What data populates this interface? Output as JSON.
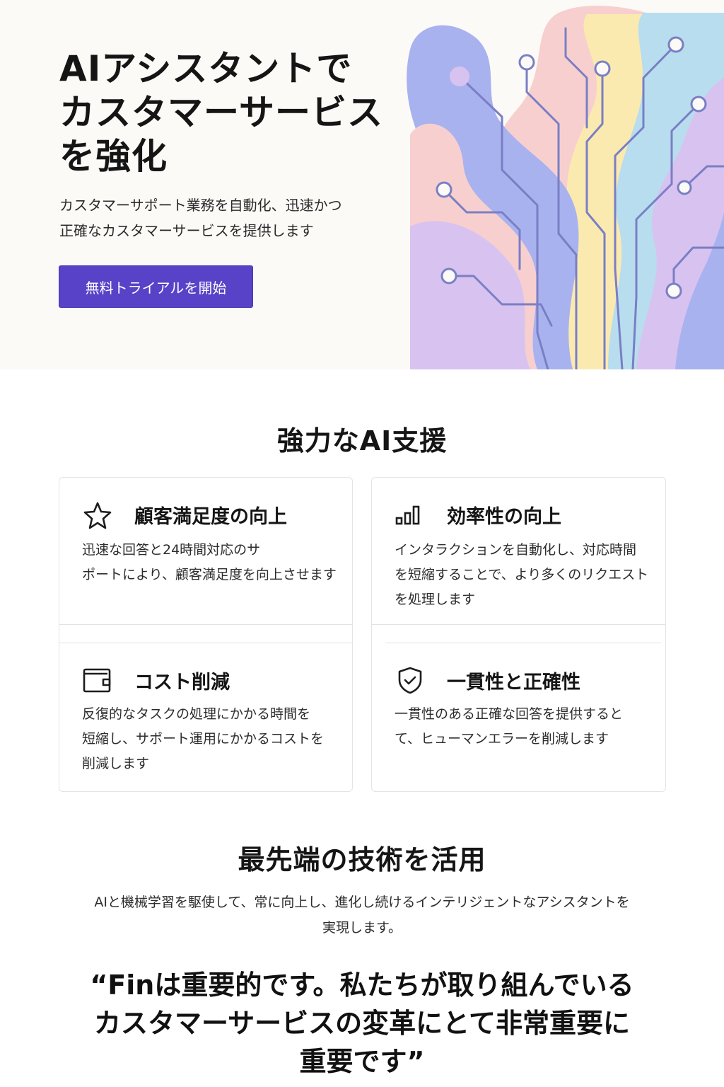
{
  "hero": {
    "title_line1": "AIアシスタントで",
    "title_line2": "カスタマーサービス",
    "title_line3": "を強化",
    "subtitle_line1": "カスタマーサポート業務を自動化、迅速かつ",
    "subtitle_line2": "正確なカスタマーサービスを提供します",
    "cta_label": "無料トライアルを開始"
  },
  "features": {
    "title": "強力なAI支援",
    "items": [
      {
        "icon": "star-icon",
        "title": "顧客満足度の向上",
        "desc_line1": "迅速な回答と24時間対応のサ",
        "desc_line2": "ポートにより、顧客満足度を向上させます"
      },
      {
        "icon": "bar-chart-icon",
        "title": "効率性の向上",
        "desc_line1": "インタラクションを自動化し、対応時間",
        "desc_line2": "を短縮することで、より多くのリクエスト",
        "desc_line3": "を処理します"
      },
      {
        "icon": "wallet-icon",
        "title": "コスト削減",
        "desc_line1": "反復的なタスクの処理にかかる時間を",
        "desc_line2": "短縮し、サポート運用にかかるコストを",
        "desc_line3": "削減します"
      },
      {
        "icon": "shield-check-icon",
        "title": "一貫性と正確性",
        "desc_line1": "一貫性のある正確な回答を提供すると",
        "desc_line2": "て、ヒューマンエラーを削減します"
      }
    ]
  },
  "tech": {
    "title": "最先端の技術を活用",
    "desc_line1": "AIと機械学習を駆使して、常に向上し、進化し続けるインテリジェントなアシスタントを",
    "desc_line2": "実現します。"
  },
  "quote": {
    "line1": "“Finは重要的です。私たちが取り組んでいる",
    "line2": "カスタマーサービスの変革にとて非常重要に",
    "line3": "重要です”"
  },
  "colors": {
    "accent": "#5842c7",
    "art_pink": "#f8cfcf",
    "art_blue": "#a8b2ef",
    "art_yellow": "#fbeab0",
    "art_cyan": "#b7ddee",
    "art_lavender": "#d8c2f0",
    "art_line": "#7a7fc4"
  }
}
